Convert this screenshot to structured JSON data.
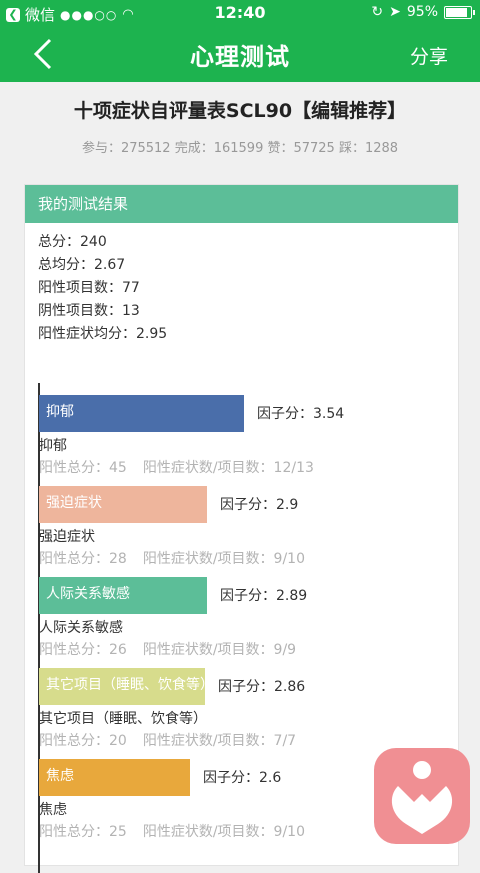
{
  "status": {
    "back_app": "微信",
    "signal": "●●●○○",
    "time": "12:40",
    "battery": "95%"
  },
  "nav": {
    "title": "心理测试",
    "share": "分享"
  },
  "page": {
    "title": "十项症状自评量表SCL90【编辑推荐】",
    "stats": "参与：275512 完成：161599 赞：57725 踩：1288"
  },
  "result": {
    "header": "我的测试结果",
    "summary": [
      "总分：240",
      "总均分：2.67",
      "阳性项目数：77",
      "阴性项目数：13",
      "阳性症状均分：2.95"
    ]
  },
  "chart_data": {
    "type": "bar",
    "categories": [
      "抑郁",
      "强迫症状",
      "人际关系敏感",
      "其它项目（睡眠、饮食等）",
      "焦虑"
    ],
    "values": [
      3.54,
      2.9,
      2.89,
      2.86,
      2.6
    ],
    "score_labels": [
      "因子分：3.54",
      "因子分：2.9",
      "因子分：2.89",
      "因子分：2.86",
      "因子分：2.6"
    ],
    "positive_totals": [
      "阳性总分：45",
      "阳性总分：28",
      "阳性总分：26",
      "阳性总分：20",
      "阳性总分：25"
    ],
    "positive_ratios": [
      "阳性症状数/项目数：12/13",
      "阳性症状数/项目数：9/10",
      "阳性症状数/项目数：9/9",
      "阳性症状数/项目数：7/7",
      "阳性症状数/项目数：9/10"
    ],
    "colors": [
      "#4a6eaa",
      "#eeb59c",
      "#5cbe98",
      "#d7dc8c",
      "#e8a83c"
    ]
  }
}
